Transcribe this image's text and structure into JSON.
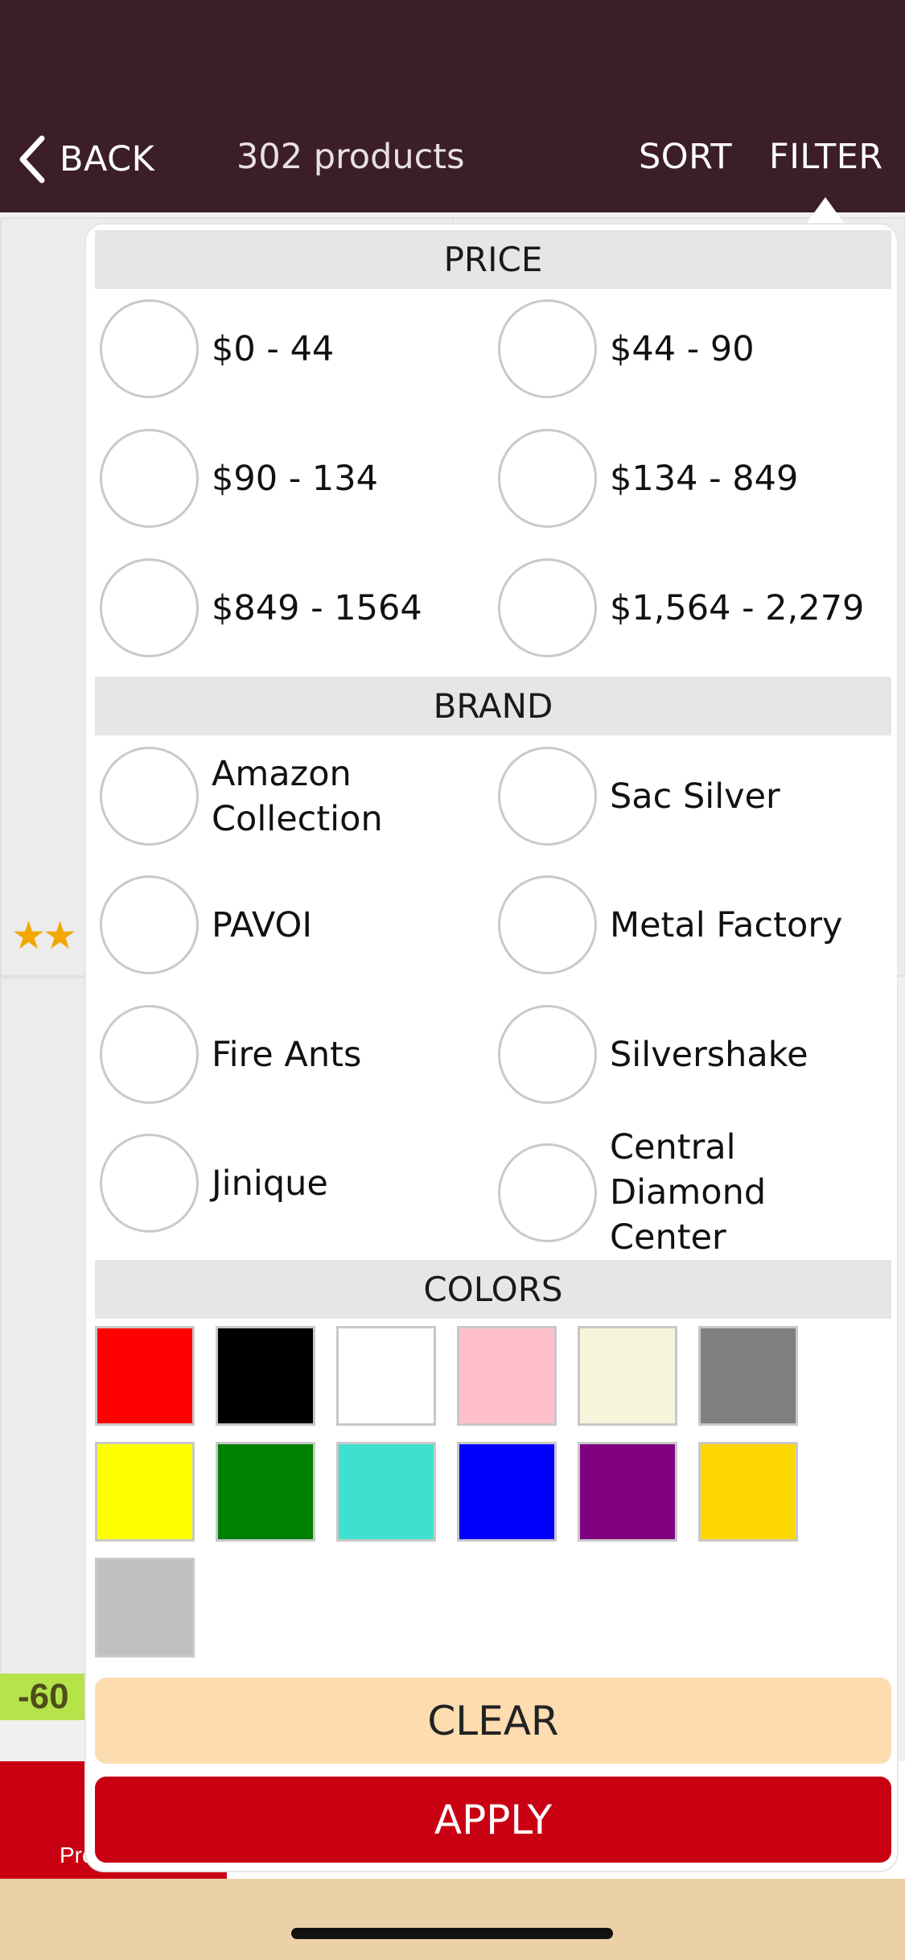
{
  "header": {
    "back_label": "BACK",
    "product_count": "302 products",
    "sort_label": "SORT",
    "filter_label": "FILTER"
  },
  "background": {
    "discount_badge": "-60",
    "tab_label": "Pro"
  },
  "filter": {
    "price": {
      "title": "PRICE",
      "options": [
        "$0 - 44",
        "$44 - 90",
        "$90 - 134",
        "$134 - 849",
        "$849 - 1564",
        "$1,564 - 2,279"
      ]
    },
    "brand": {
      "title": "BRAND",
      "options": [
        "Amazon\nCollection",
        "Sac Silver",
        "PAVOI",
        "Metal Factory",
        "Fire Ants",
        "Silvershake",
        "Jinique",
        "Central\nDiamond\nCenter"
      ]
    },
    "colors": {
      "title": "COLORS",
      "swatches": [
        {
          "name": "red",
          "hex": "#ff0000"
        },
        {
          "name": "black",
          "hex": "#000000"
        },
        {
          "name": "white",
          "hex": "#ffffff"
        },
        {
          "name": "pink",
          "hex": "#ffc0cb"
        },
        {
          "name": "beige",
          "hex": "#f5f5dc"
        },
        {
          "name": "gray",
          "hex": "#808080"
        },
        {
          "name": "yellow",
          "hex": "#ffff00"
        },
        {
          "name": "green",
          "hex": "#008000"
        },
        {
          "name": "turquoise",
          "hex": "#40e0d0"
        },
        {
          "name": "blue",
          "hex": "#0000ff"
        },
        {
          "name": "purple",
          "hex": "#800080"
        },
        {
          "name": "gold",
          "hex": "#ffd700"
        },
        {
          "name": "silver",
          "hex": "#c0c0c0"
        }
      ]
    },
    "clear_label": "CLEAR",
    "apply_label": "APPLY"
  }
}
